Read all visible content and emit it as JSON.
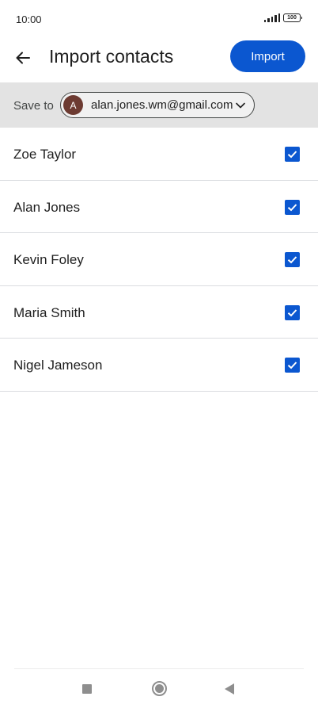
{
  "status_bar": {
    "time": "10:00",
    "battery": "100",
    "icons": [
      "signal-icon",
      "battery-icon"
    ]
  },
  "app_bar": {
    "back_icon": "arrow-back-icon",
    "title": "Import contacts",
    "import_label": "Import"
  },
  "save_to": {
    "label": "Save to",
    "avatar_initial": "A",
    "email": "alan.jones.wm@gmail.com",
    "dropdown_icon": "chevron-down-icon"
  },
  "contacts": [
    {
      "name": "Zoe Taylor",
      "checked": true
    },
    {
      "name": "Alan Jones",
      "checked": true
    },
    {
      "name": "Kevin Foley",
      "checked": true
    },
    {
      "name": "Maria Smith",
      "checked": true
    },
    {
      "name": "Nigel Jameson",
      "checked": true
    }
  ],
  "nav_bar": {
    "icons": [
      "recents-icon",
      "home-icon",
      "back-icon"
    ]
  },
  "colors": {
    "accent": "#0b57d0",
    "save_bar_bg": "#e3e3e3",
    "avatar_bg": "#6d3b32"
  }
}
